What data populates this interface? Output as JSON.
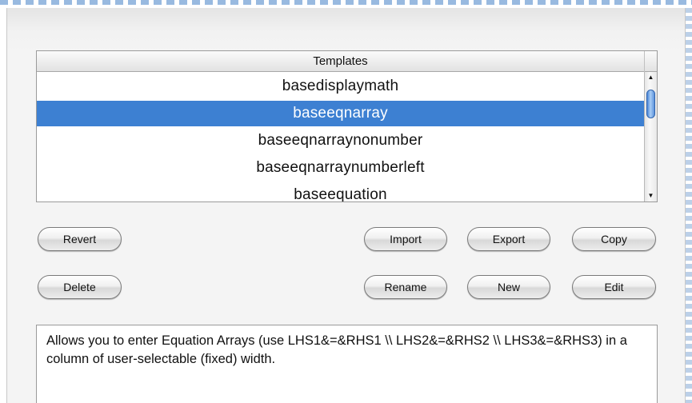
{
  "templates": {
    "header": "Templates",
    "items": [
      "basedisplaymath",
      "baseeqnarray",
      "baseeqnarraynonumber",
      "baseeqnarraynumberleft",
      "baseequation"
    ],
    "selected": "baseeqnarray"
  },
  "buttons": {
    "revert": "Revert",
    "import": "Import",
    "export": "Export",
    "copy": "Copy",
    "delete": "Delete",
    "rename": "Rename",
    "new": "New",
    "edit": "Edit"
  },
  "description": "Allows you to enter Equation Arrays (use LHS1&=&RHS1 \\\\ LHS2&=&RHS2 \\\\ LHS3&=&RHS3) in a column of user-selectable (fixed) width.",
  "colors": {
    "selection": "#3d80d2",
    "selection_text": "#ffffff"
  },
  "icons": {
    "scroll_up": "arrow-up-icon",
    "scroll_down": "arrow-down-icon"
  }
}
